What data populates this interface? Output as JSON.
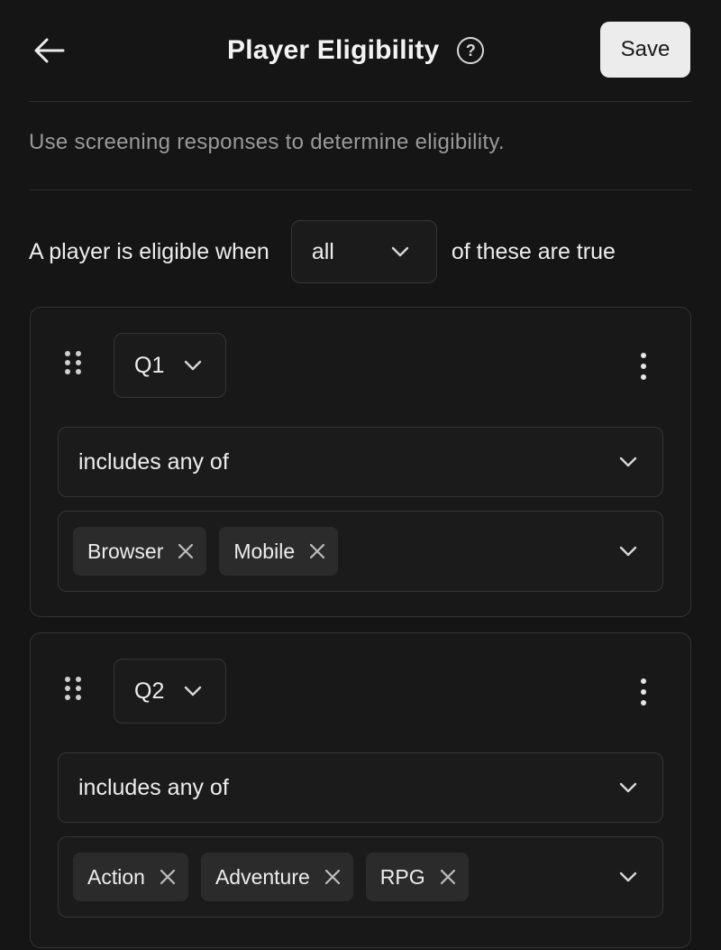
{
  "header": {
    "title": "Player Eligibility",
    "help_glyph": "?",
    "save_label": "Save"
  },
  "description": "Use screening responses to determine eligibility.",
  "rule": {
    "prefix": "A player is eligible when",
    "match_value": "all",
    "suffix": "of these are true"
  },
  "conditions": [
    {
      "question": "Q1",
      "operator": "includes any of",
      "values": [
        "Browser",
        "Mobile"
      ]
    },
    {
      "question": "Q2",
      "operator": "includes any of",
      "values": [
        "Action",
        "Adventure",
        "RPG"
      ]
    }
  ],
  "icons": {
    "back": "arrow-left-icon",
    "help": "help-circle-icon",
    "dropdown": "chevron-down-icon",
    "drag": "drag-handle-icon",
    "more": "more-vertical-icon",
    "remove": "close-icon"
  },
  "colors": {
    "background": "#151515",
    "card": "#181818",
    "border": "#333333",
    "chip": "#2b2b2b",
    "save_button": "#ececec",
    "muted_text": "#9a9a9a"
  }
}
